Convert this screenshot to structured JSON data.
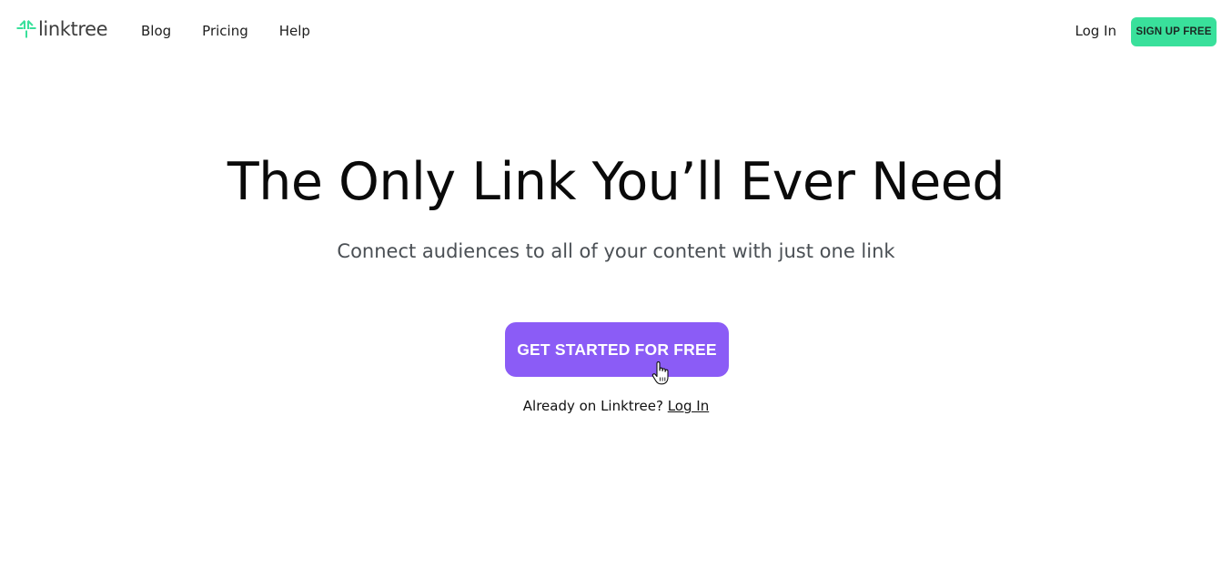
{
  "brand": {
    "name": "linktree",
    "logo_icon": "linktree-logo-icon",
    "color": "#39e09b"
  },
  "nav": {
    "links": [
      {
        "label": "Blog"
      },
      {
        "label": "Pricing"
      },
      {
        "label": "Help"
      }
    ],
    "login_label": "Log In",
    "signup_label": "SIGN UP FREE"
  },
  "hero": {
    "title": "The Only Link You’ll Ever Need",
    "subtitle": "Connect audiences to all of your content with just one link",
    "cta_label": "GET STARTED FOR FREE",
    "cta_color": "#8b5cf6",
    "login_prompt": "Already on Linktree?",
    "login_link": "Log In"
  },
  "pointer": {
    "icon": "hand-pointer-cursor-icon"
  }
}
